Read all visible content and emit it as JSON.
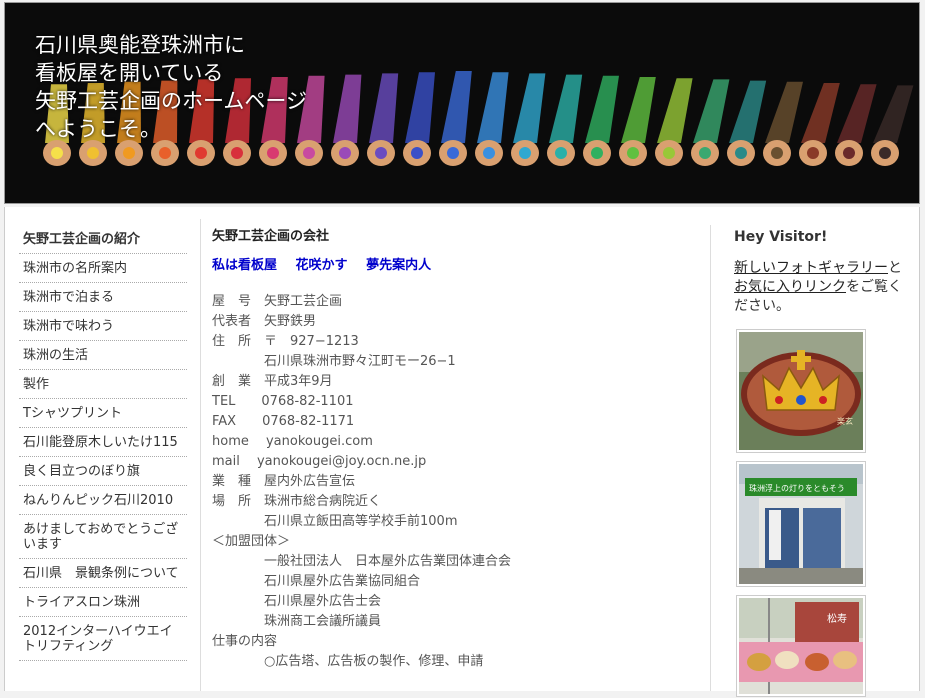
{
  "header": {
    "title_lines": [
      "石川県奥能登珠洲市に",
      "看板屋を開いている",
      "矢野工芸企画のホームページ",
      "へようこそ。"
    ]
  },
  "sidebar": {
    "items": [
      {
        "label": "矢野工芸企画の紹介"
      },
      {
        "label": "珠洲市の名所案内"
      },
      {
        "label": "珠洲市で泊まる"
      },
      {
        "label": "珠洲市で味わう"
      },
      {
        "label": "珠洲の生活"
      },
      {
        "label": "製作"
      },
      {
        "label": "Tシャツプリント"
      },
      {
        "label": "石川能登原木しいたけ115"
      },
      {
        "label": "良く目立つのぼり旗"
      },
      {
        "label": "ねんりんピック石川2010"
      },
      {
        "label": "あけましておめでとうございます"
      },
      {
        "label": "石川県　景観条例について"
      },
      {
        "label": "トライアスロン珠洲"
      },
      {
        "label": "2012インターハイウエイトリフティング"
      }
    ]
  },
  "content": {
    "title": "矢野工芸企画の会社",
    "links": [
      "私は看板屋",
      "花咲かす",
      "夢先案内人"
    ],
    "lines": [
      "屋　号　矢野工芸企画",
      "代表者　矢野鉄男",
      "住　所　〒　927−1213",
      "　　　　石川県珠洲市野々江町モー26−1",
      "創　業　平成3年9月",
      "TEL　　0768-82-1101",
      "FAX　　0768-82-1171",
      "home　 yanokougei.com",
      "mail　 yanokougei@joy.ocn.ne.jp",
      "業　種　屋内外広告宣伝",
      "場　所　珠洲市総合病院近く",
      "　　　　石川県立飯田高等学校手前100m",
      "＜加盟団体＞",
      "　　　　一般社団法人　日本屋外広告業団体連合会",
      "　　　　石川県屋外広告業協同組合",
      "　　　　石川県屋外広告士会",
      "　　　　珠洲商工会議所議員",
      "",
      "仕事の内容",
      "　　　　○広告塔、広告板の製作、修理、申請"
    ]
  },
  "right": {
    "title": "Hey Visitor!",
    "link1": "新しいフォトギャラリー",
    "text1": "と",
    "link2": "お気に入りリンク",
    "text2": "をご覧ください。",
    "photos": [
      {
        "sign_text": "楽玄"
      },
      {
        "sign_text": "珠洲浮上の灯りをともそう"
      },
      {
        "sign_text": "松寿"
      }
    ]
  },
  "colors": {
    "link_blue": "#0000cc",
    "header_bg": "#0b0b0b"
  }
}
